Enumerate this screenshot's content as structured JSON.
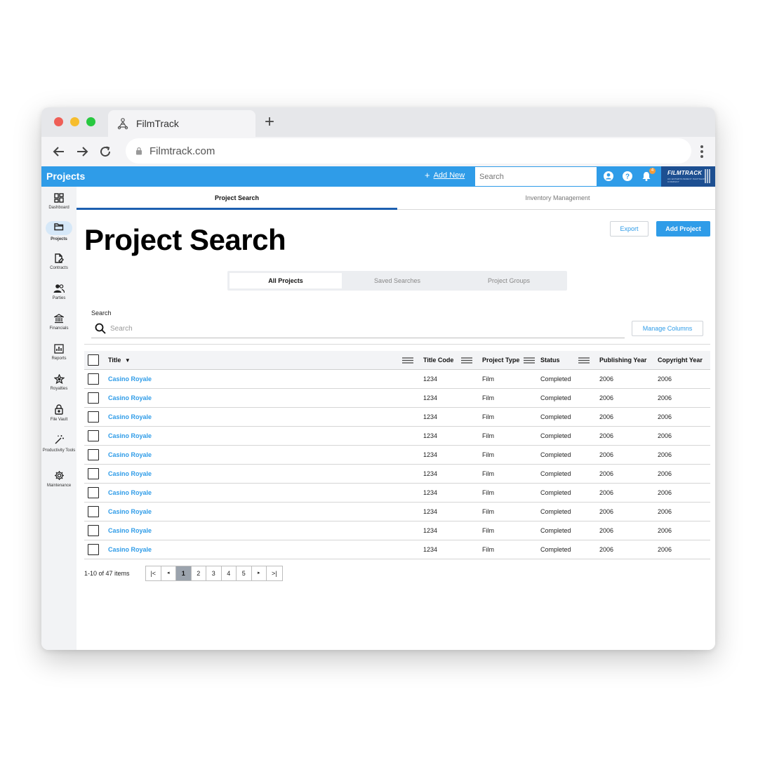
{
  "browser": {
    "tab_title": "FilmTrack",
    "new_tab_label": "+",
    "url": "Filmtrack.com"
  },
  "appbar": {
    "title": "Projects",
    "add_new_label": "Add New",
    "search_placeholder": "Search",
    "notification_count": "4",
    "brand_name": "FilmTrack",
    "brand_subtitle": "AN ENTERTAINMENT PARTNERS COMPANY",
    "accent_color": "#2f9ce8"
  },
  "sidebar": {
    "items": [
      {
        "label": "Dashboard",
        "icon": "dashboard-icon"
      },
      {
        "label": "Projects",
        "icon": "folder-icon",
        "active": true
      },
      {
        "label": "Contracts",
        "icon": "contract-icon"
      },
      {
        "label": "Parties",
        "icon": "people-icon"
      },
      {
        "label": "Financials",
        "icon": "bank-icon"
      },
      {
        "label": "Reports",
        "icon": "chart-icon"
      },
      {
        "label": "Royalties",
        "icon": "star-icon"
      },
      {
        "label": "File Vault",
        "icon": "lock-icon"
      },
      {
        "label": "Productivity Tools",
        "icon": "magic-wand-icon"
      },
      {
        "label": "Maintenance",
        "icon": "gear-icon"
      }
    ]
  },
  "tabs": {
    "project_search": "Project Search",
    "inventory_management": "Inventory Management"
  },
  "page": {
    "heading": "Project Search",
    "export_label": "Export",
    "add_project_label": "Add Project"
  },
  "segments": {
    "all_projects": "All Projects",
    "saved_searches": "Saved Searches",
    "project_groups": "Project Groups"
  },
  "search": {
    "label": "Search",
    "placeholder": "Search",
    "manage_columns_label": "Manage Columns"
  },
  "table": {
    "columns": [
      "Title",
      "Title Code",
      "Project Type",
      "Status",
      "Publishing Year",
      "Copyright Year"
    ],
    "rows": [
      [
        "Casino Royale",
        "1234",
        "Film",
        "Completed",
        "2006",
        "2006"
      ],
      [
        "Casino Royale",
        "1234",
        "Film",
        "Completed",
        "2006",
        "2006"
      ],
      [
        "Casino Royale",
        "1234",
        "Film",
        "Completed",
        "2006",
        "2006"
      ],
      [
        "Casino Royale",
        "1234",
        "Film",
        "Completed",
        "2006",
        "2006"
      ],
      [
        "Casino Royale",
        "1234",
        "Film",
        "Completed",
        "2006",
        "2006"
      ],
      [
        "Casino Royale",
        "1234",
        "Film",
        "Completed",
        "2006",
        "2006"
      ],
      [
        "Casino Royale",
        "1234",
        "Film",
        "Completed",
        "2006",
        "2006"
      ],
      [
        "Casino Royale",
        "1234",
        "Film",
        "Completed",
        "2006",
        "2006"
      ],
      [
        "Casino Royale",
        "1234",
        "Film",
        "Completed",
        "2006",
        "2006"
      ],
      [
        "Casino Royale",
        "1234",
        "Film",
        "Completed",
        "2006",
        "2006"
      ]
    ]
  },
  "pagination": {
    "summary": "1-10 of 47 items",
    "pages": [
      "1",
      "2",
      "3",
      "4",
      "5"
    ],
    "current": "1"
  }
}
